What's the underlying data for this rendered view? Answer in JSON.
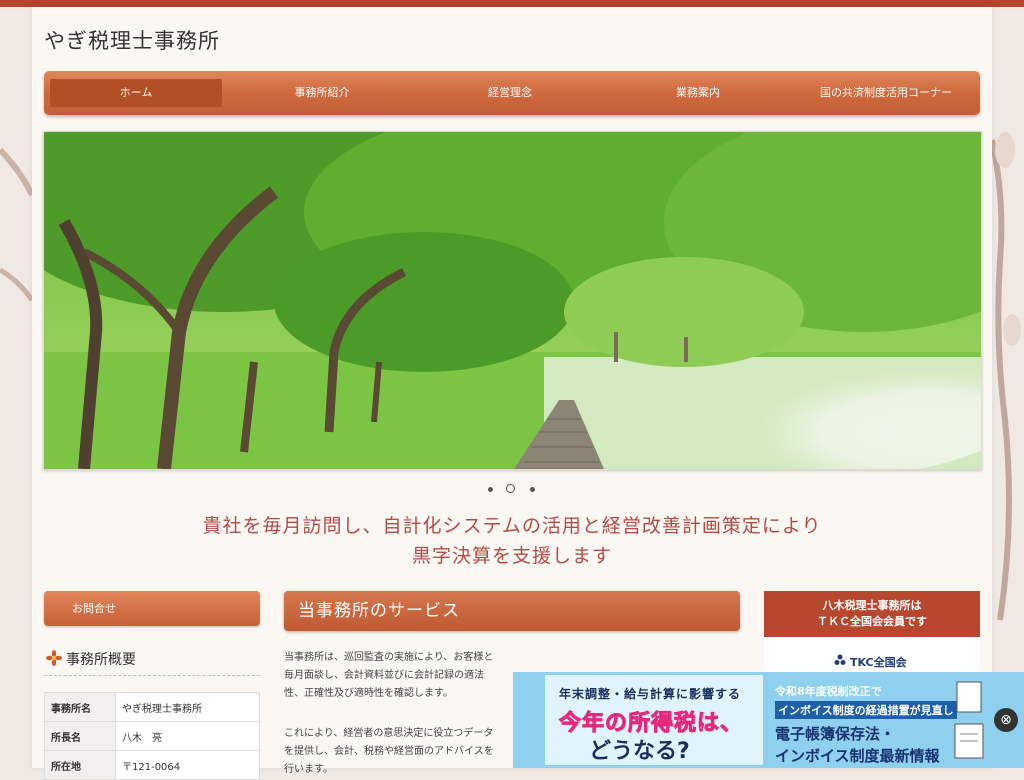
{
  "site": {
    "title": "やぎ税理士事務所"
  },
  "nav": {
    "items": [
      {
        "label": "ホーム"
      },
      {
        "label": "事務所紹介"
      },
      {
        "label": "経営理念"
      },
      {
        "label": "業務案内"
      },
      {
        "label": "国の共済制度活用コーナー"
      }
    ]
  },
  "tagline": {
    "line1": "貴社を毎月訪問し、自計化システムの活用と経営改善計画策定により",
    "line2": "黒字決算を支援します"
  },
  "sidebar": {
    "contact_label": "お問合せ",
    "overview_title": "事務所概要",
    "table": [
      {
        "key": "事務所名",
        "value": "やぎ税理士事務所"
      },
      {
        "key": "所長名",
        "value": "八木　亮"
      },
      {
        "key": "所在地",
        "value": "〒121-0064"
      }
    ]
  },
  "services": {
    "title": "当事務所のサービス",
    "para1": "当事務所は、巡回監査の実施により、お客様と毎月面談し、会計資料並びに会計記録の適法性、正確性及び適時性を確認します。",
    "para2": "これにより、経営者の意思決定に役立つデータを提供し、会計、税務や経営面のアドバイスを行います。"
  },
  "member": {
    "line1": "八木税理士事務所は",
    "line2": "ＴＫＣ全国会会員です",
    "logo_text": "TKC全国会"
  },
  "ad": {
    "left_line1": "年末調整・給与計算に影響する",
    "left_line2": "今年の所得税は、",
    "left_line3": "どうなる?",
    "right_line1": "令和8年度税制改正で",
    "right_line2": "インボイス制度の経過措置が見直し",
    "right_line3": "電子帳簿保存法・",
    "right_line4": "インボイス制度最新情報",
    "close_glyph": "⊗"
  },
  "slider": {
    "slides": 3,
    "active_index": 1
  },
  "colors": {
    "accent": "#c45d34",
    "tagline": "#b44a43",
    "topbar": "#b4452c"
  }
}
